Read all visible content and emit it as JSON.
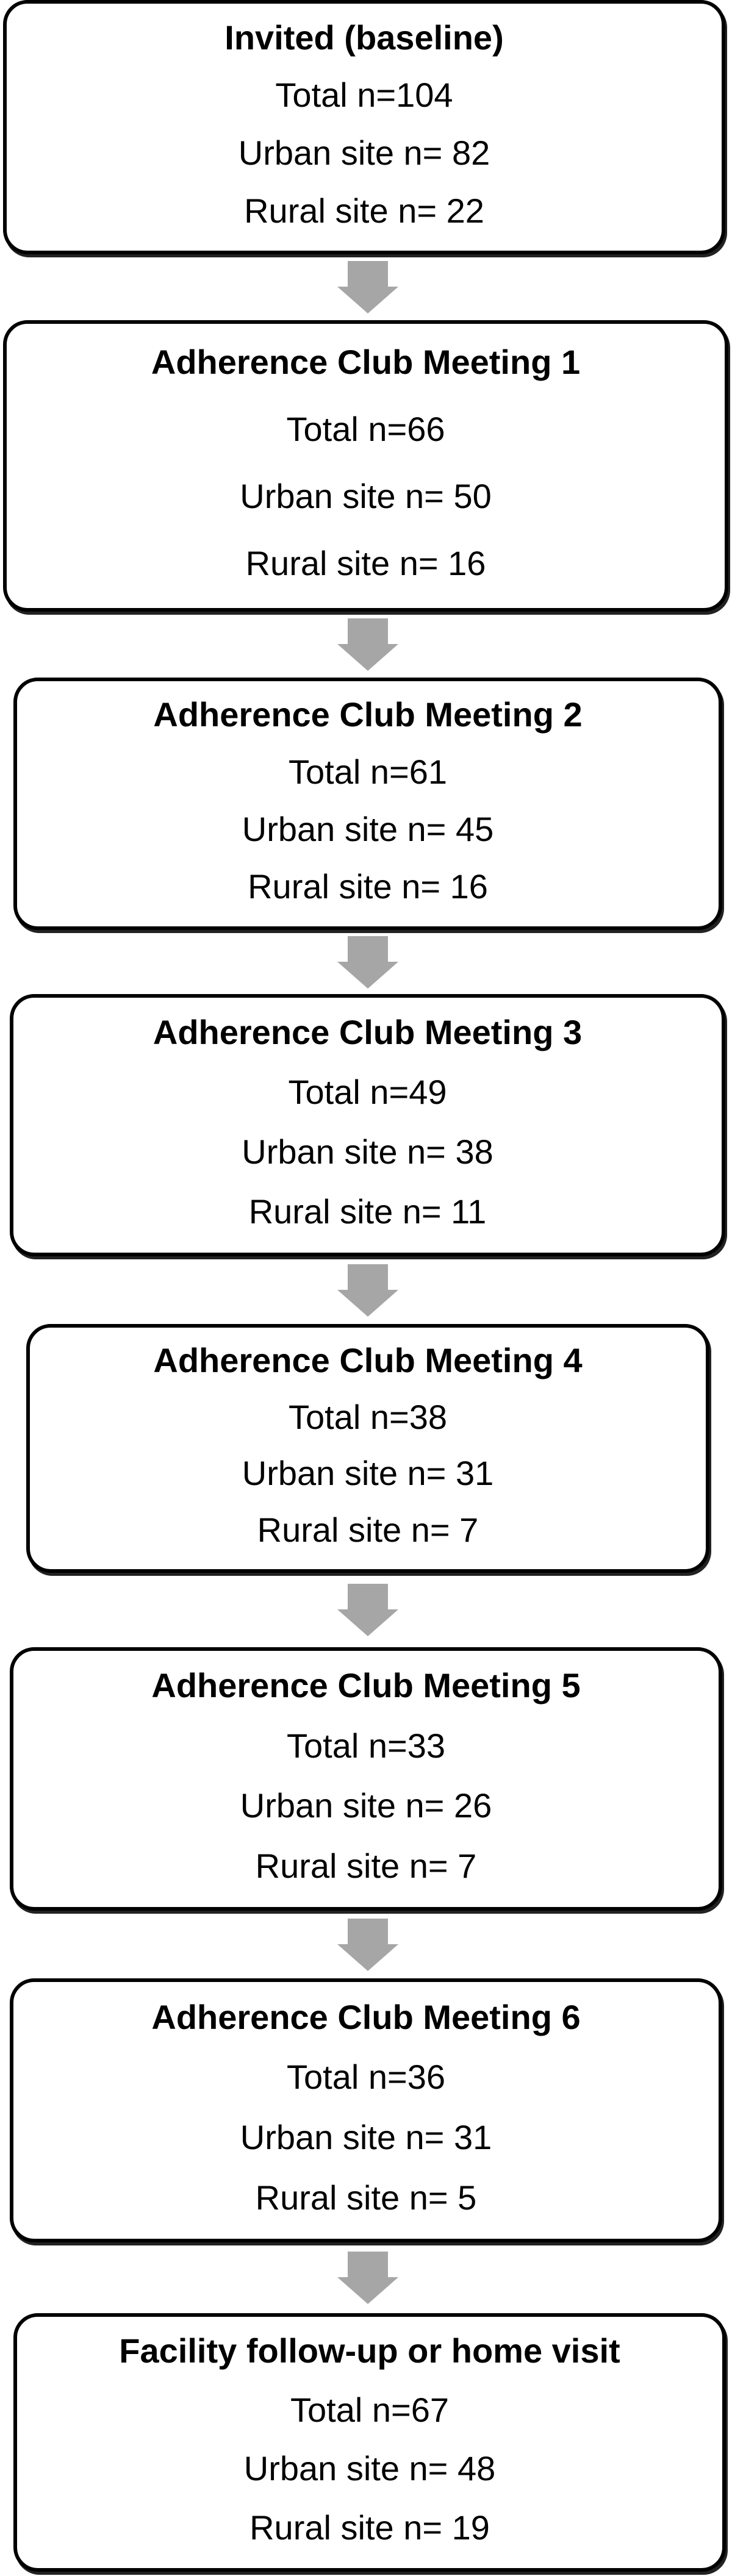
{
  "arrow_color": "#a6a6a6",
  "boxes": [
    {
      "title": "Invited (baseline)",
      "total": "Total n=104",
      "urban": "Urban site n= 82",
      "rural": "Rural site n= 22"
    },
    {
      "title": "Adherence Club Meeting 1",
      "total": "Total n=66",
      "urban": "Urban site n= 50",
      "rural": "Rural site n= 16"
    },
    {
      "title": "Adherence Club Meeting 2",
      "total": "Total n=61",
      "urban": "Urban site n= 45",
      "rural": "Rural site n= 16"
    },
    {
      "title": "Adherence Club Meeting 3",
      "total": "Total n=49",
      "urban": "Urban site n= 38",
      "rural": "Rural site n= 11"
    },
    {
      "title": "Adherence Club Meeting 4",
      "total": "Total n=38",
      "urban": "Urban site n= 31",
      "rural": "Rural site n= 7"
    },
    {
      "title": "Adherence Club Meeting 5",
      "total": "Total n=33",
      "urban": "Urban site n= 26",
      "rural": "Rural site n= 7"
    },
    {
      "title": "Adherence Club Meeting 6",
      "total": "Total n=36",
      "urban": "Urban site n= 31",
      "rural": "Rural site n= 5"
    },
    {
      "title": "Facility follow-up or home visit",
      "total": "Total n=67",
      "urban": "Urban site n= 48",
      "rural": "Rural site n= 19"
    }
  ]
}
